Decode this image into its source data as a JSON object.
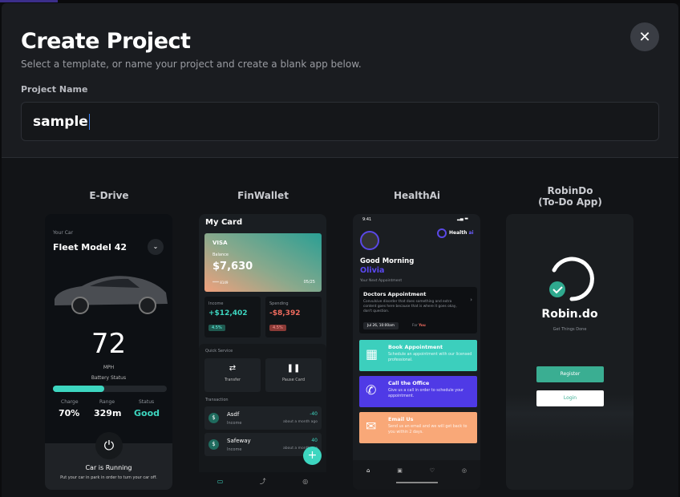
{
  "modal": {
    "title": "Create Project",
    "subtitle": "Select a template, or name your project and create a blank app below.",
    "close_icon": "close-icon",
    "project_name_label": "Project Name",
    "project_name_value": "sample"
  },
  "templates": [
    {
      "name": "E-Drive",
      "screen": {
        "your_car": "Your Car",
        "model": "Fleet Model 42",
        "speed": "72",
        "unit": "MPH",
        "battery_label": "Battery Status",
        "battery_level": 0.45,
        "charge_label": "Charge",
        "charge": "70%",
        "range_label": "Range",
        "range": "329m",
        "status_label": "Status",
        "status": "Good",
        "running": "Car is Running",
        "running_hint": "Put your car in park in order to turn your car off."
      }
    },
    {
      "name": "FinWallet",
      "screen": {
        "title": "My Card",
        "brand": "VISA",
        "balance_label": "Balance",
        "balance": "$7,630",
        "card_number": "**** 8149",
        "expiry": "05/25",
        "income_label": "Income",
        "income": "+$12,402",
        "income_pct": "4.5%",
        "spending_label": "Spending",
        "spending": "-$8,392",
        "spending_pct": "4.5%",
        "quick_service": "Quick Service",
        "transfer": "Transfer",
        "pause": "Pause Card",
        "transaction": "Transaction",
        "tx": [
          {
            "name": "Asdf",
            "type": "Income",
            "amount": "-40",
            "time": "about a month ago"
          },
          {
            "name": "Safeway",
            "type": "Income",
            "amount": "40",
            "time": "about a month ago"
          }
        ]
      }
    },
    {
      "name": "HealthAi",
      "screen": {
        "time": "9:41",
        "logo": "Health",
        "logo_suffix": "ai",
        "greeting": "Good Morning",
        "user": "Olivia",
        "next": "Your Next Appointment",
        "appt_title": "Doctors Appointment",
        "appt_desc": "Convulsive disorder that does something and extra content goes here because that is where it goes okay, don't question.",
        "appt_date": "Jul 26, 10:00am",
        "for": "For",
        "for_who": "You",
        "actions": [
          {
            "title": "Book Appointment",
            "desc": "Schedule an appointment with our licensed professional.",
            "color": "#3ccfbd",
            "icon": "calendar-icon"
          },
          {
            "title": "Call the Office",
            "desc": "Give us a call in order to schedule your appointment.",
            "color": "#4f3ae6",
            "icon": "phone-icon"
          },
          {
            "title": "Email Us",
            "desc": "Send us an email and we will get back to you within 2 days.",
            "color": "#f9a878",
            "icon": "mail-icon"
          }
        ]
      }
    },
    {
      "name": "RobinDo",
      "name_line2": "(To-Do App)",
      "screen": {
        "brand": "Robin.do",
        "tagline": "Get Things Done",
        "register": "Register",
        "login": "Login"
      }
    }
  ]
}
